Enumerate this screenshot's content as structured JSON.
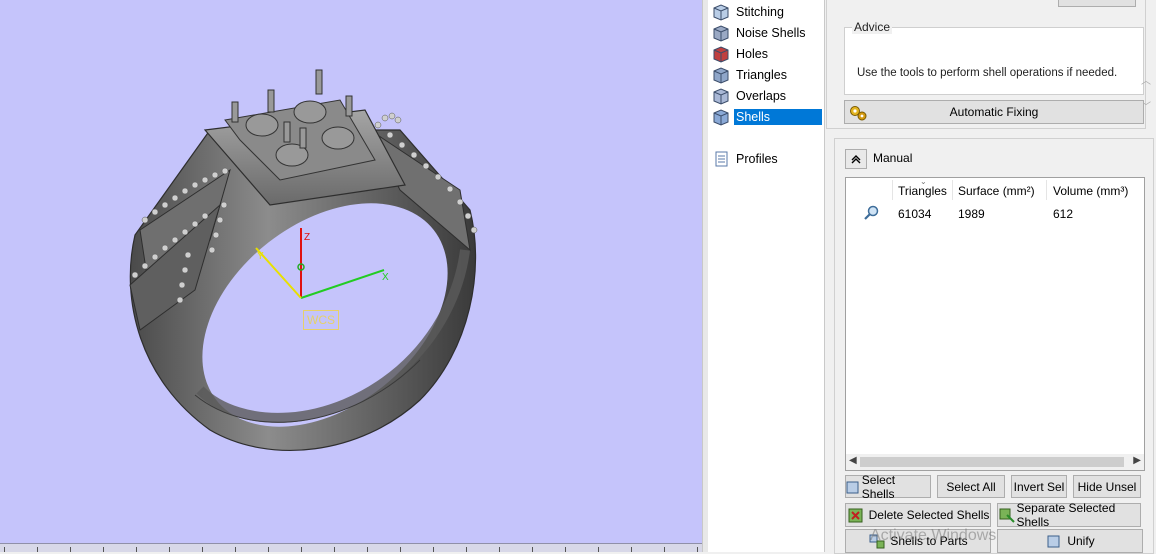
{
  "viewport": {
    "wcs_label": "WCS",
    "axis_labels": {
      "z": "Z",
      "x": "X",
      "y": "Y"
    },
    "background_color": "#c5c4fb"
  },
  "tree": {
    "items": [
      {
        "label": "Stitching",
        "icon": "stitching-icon",
        "selected": false
      },
      {
        "label": "Noise Shells",
        "icon": "noise-shells-icon",
        "selected": false
      },
      {
        "label": "Holes",
        "icon": "holes-icon",
        "selected": false
      },
      {
        "label": "Triangles",
        "icon": "triangles-icon",
        "selected": false
      },
      {
        "label": "Overlaps",
        "icon": "overlaps-icon",
        "selected": false
      },
      {
        "label": "Shells",
        "icon": "shells-icon",
        "selected": true
      },
      {
        "label": "Profiles",
        "icon": "profiles-icon",
        "selected": false
      }
    ]
  },
  "advice": {
    "legend": "Advice",
    "text": "Use the tools to perform shell operations if needed.",
    "automatic_fixing_label": "Automatic Fixing"
  },
  "manual": {
    "label": "Manual",
    "columns": [
      "Triangles",
      "Surface (mm²)",
      "Volume (mm³)"
    ],
    "rows": [
      {
        "triangles": "61034",
        "surface": "1989",
        "volume": "612"
      }
    ]
  },
  "buttons": {
    "select_shells": "Select Shells",
    "select_all": "Select All",
    "invert_sel": "Invert Sel",
    "hide_unsel": "Hide Unsel",
    "delete_selected_shells": "Delete Selected Shells",
    "separate_selected_shells": "Separate Selected Shells",
    "shells_to_parts": "Shells to Parts",
    "unify": "Unify"
  },
  "watermark": "Activate Windows",
  "colors": {
    "selection": "#0078d7",
    "wcs": "#e6d16a"
  }
}
